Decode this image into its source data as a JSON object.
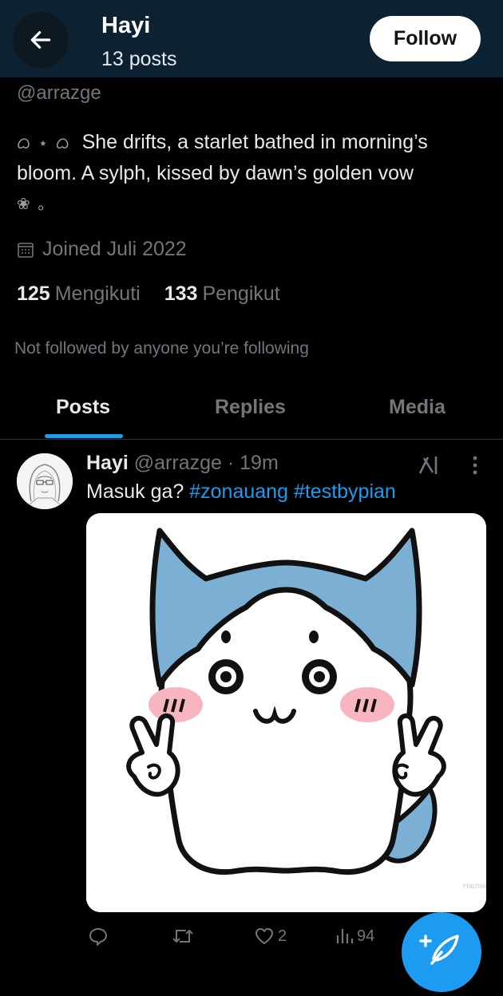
{
  "header": {
    "name": "Hayi",
    "post_count": "13 posts",
    "follow_label": "Follow",
    "background": "#0c2233"
  },
  "profile": {
    "handle": "@arrazge",
    "bio_deco_start": "ᜊ ⋆ ᜊ",
    "bio_text": "She drifts, a starlet bathed in morning’s bloom. A sylph, kissed by dawn’s golden vow",
    "bio_deco_end": "❀ ｡",
    "joined": "Joined Juli 2022",
    "following_count": "125",
    "following_label": "Mengikuti",
    "followers_count": "133",
    "followers_label": "Pengikut",
    "not_followed": "Not followed by anyone you’re following"
  },
  "tabs": [
    {
      "label": "Posts",
      "active": true
    },
    {
      "label": "Replies",
      "active": false
    },
    {
      "label": "Media",
      "active": false
    }
  ],
  "post": {
    "name": "Hayi",
    "handle": "@arrazge",
    "time": "· 19m",
    "text": "Masuk ga?",
    "hashtag_1": "#zonauang",
    "hashtag_2": "#testbypian",
    "likes": "2",
    "views": "94",
    "watermark": "Hachiware"
  },
  "icons": {
    "back": "arrow-left-icon",
    "calendar": "calendar-icon",
    "grok": "grok-icon",
    "more": "more-vertical-icon",
    "reply": "reply-icon",
    "repost": "repost-icon",
    "like": "heart-icon",
    "views": "views-icon",
    "compose": "compose-icon"
  },
  "colors": {
    "accent": "#1d9bf0",
    "muted": "#71767b",
    "background": "#000000"
  }
}
